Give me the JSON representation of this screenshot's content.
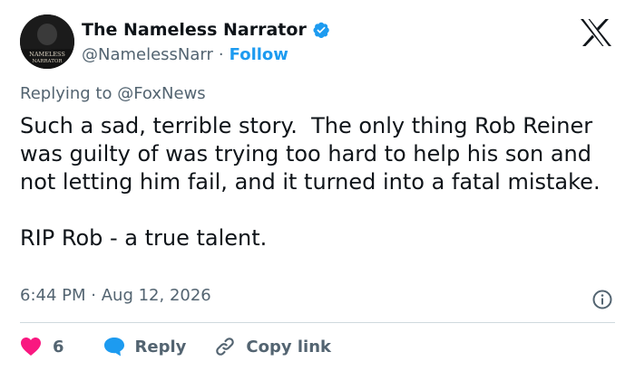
{
  "author": {
    "display_name": "The Nameless Narrator",
    "handle": "@NamelessNarr",
    "separator": "·",
    "follow_label": "Follow",
    "avatar_text_line1": "NAMELESS",
    "avatar_text_line2": "NARRATOR",
    "verified_color": "#1d9bf0"
  },
  "reply_context": {
    "prefix": "Replying to",
    "mention": "@FoxNews"
  },
  "tweet": {
    "text": "Such a sad, terrible story.  The only thing Rob Reiner was guilty of was trying too hard to help his son and not letting him fail, and it turned into a fatal mistake.\n\nRIP Rob - a true talent.",
    "time": "6:44 PM",
    "date": "Aug 12, 2026",
    "separator": "·"
  },
  "actions": {
    "like_count": "6",
    "reply_label": "Reply",
    "copy_link_label": "Copy link",
    "like_color": "#f91880",
    "reply_color": "#1d9bf0"
  },
  "icons": {
    "platform": "x-logo-icon",
    "verified": "verified-badge-icon",
    "info": "info-icon",
    "like": "heart-icon",
    "reply": "speech-bubble-icon",
    "copy": "link-icon"
  }
}
